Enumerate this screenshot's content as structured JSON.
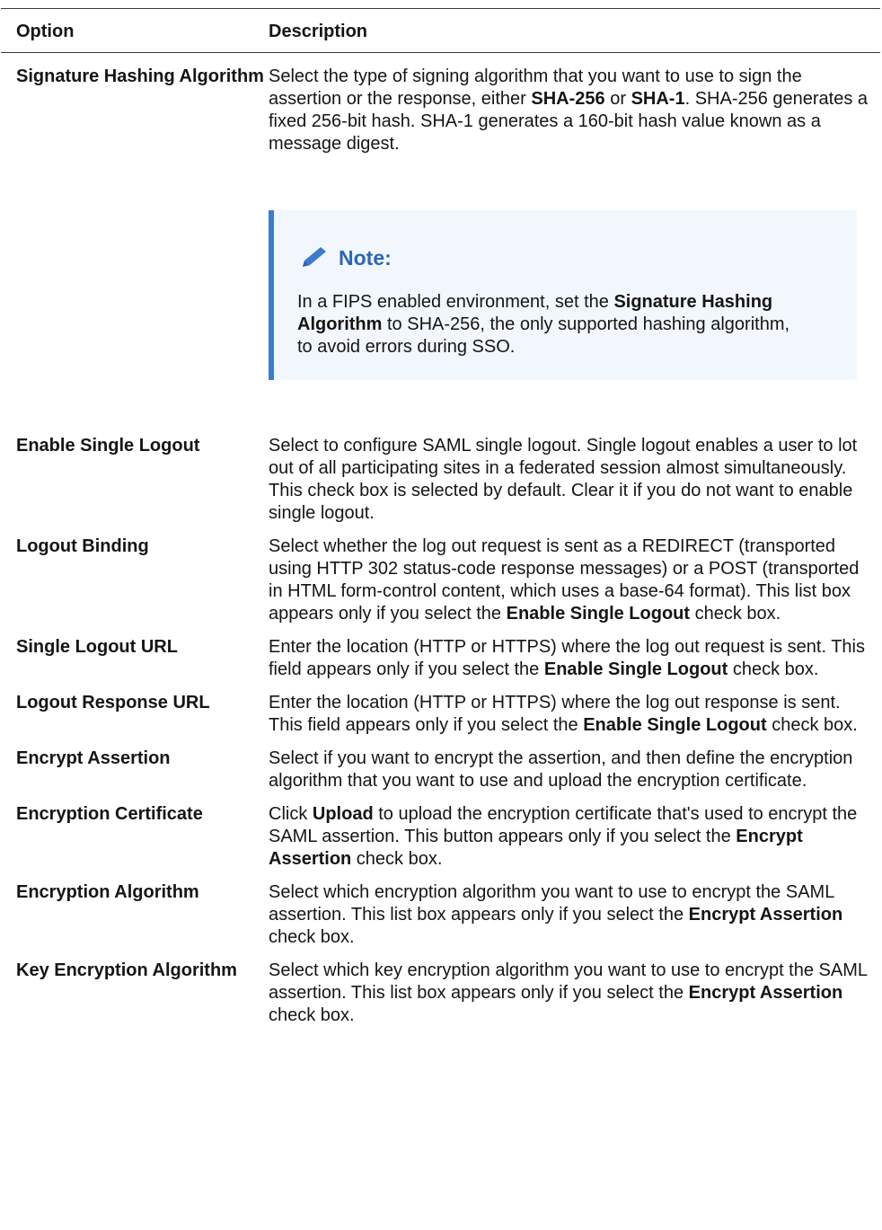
{
  "table": {
    "header": {
      "option": "Option",
      "description": "Description"
    },
    "rows": [
      {
        "option": "Signature Hashing Algorithm",
        "desc_parts": [
          "Select the type of signing algorithm that you want to use to sign the assertion or the response, either ",
          "SHA-256",
          " or ",
          "SHA-1",
          ". SHA-256 generates a fixed 256-bit hash. SHA-1 generates a 160-bit hash value known as a message digest."
        ],
        "note": {
          "title": "Note:",
          "parts": [
            "In a FIPS enabled environment, set the ",
            "Signature Hashing Algorithm",
            " to SHA-256, the only supported hashing algorithm, to avoid errors during SSO."
          ]
        }
      },
      {
        "option": "Enable Single Logout",
        "desc": "Select to configure SAML single logout. Single logout enables a user to lot out of all participating sites in a federated session almost simultaneously. This check box is selected by default. Clear it if you do not want to enable single logout."
      },
      {
        "option": "Logout Binding",
        "desc_parts": [
          "Select whether the log out request is sent as a REDIRECT (transported using HTTP 302 status-code response messages) or a POST (transported in HTML form-control content, which uses a base-64 format). This list box appears only if you select the ",
          "Enable Single Logout",
          " check box."
        ]
      },
      {
        "option": "Single Logout URL",
        "desc_parts": [
          "Enter the location (HTTP or HTTPS) where the log out request is sent. This field appears only if you select the ",
          "Enable Single Logout",
          " check box."
        ]
      },
      {
        "option": "Logout Response URL",
        "desc_parts": [
          "Enter the location (HTTP or HTTPS) where the log out response is sent. This field appears only if you select the ",
          "Enable Single Logout",
          " check box."
        ]
      },
      {
        "option": "Encrypt Assertion",
        "desc": "Select if you want to encrypt the assertion, and then define the encryption algorithm that you want to use and upload the encryption certificate."
      },
      {
        "option": "Encryption Certificate",
        "desc_parts": [
          "Click ",
          "Upload",
          " to upload the encryption certificate that's used to encrypt the SAML assertion. This button appears only if you select the ",
          "Encrypt Assertion",
          " check box."
        ]
      },
      {
        "option": "Encryption Algorithm",
        "desc_parts": [
          "Select which encryption algorithm you want to use to encrypt the SAML assertion. This list box appears only if you select the ",
          "Encrypt Assertion",
          " check box."
        ]
      },
      {
        "option": "Key Encryption Algorithm",
        "desc_parts": [
          "Select which key encryption algorithm you want to use to encrypt the SAML assertion. This list box appears only if you select the ",
          "Encrypt Assertion",
          " check box."
        ]
      }
    ]
  },
  "colors": {
    "note_accent": "#3d7ccc",
    "note_bg": "#f1f7fd",
    "note_title": "#2a67b3"
  },
  "icons": {
    "note": "pencil-icon"
  }
}
